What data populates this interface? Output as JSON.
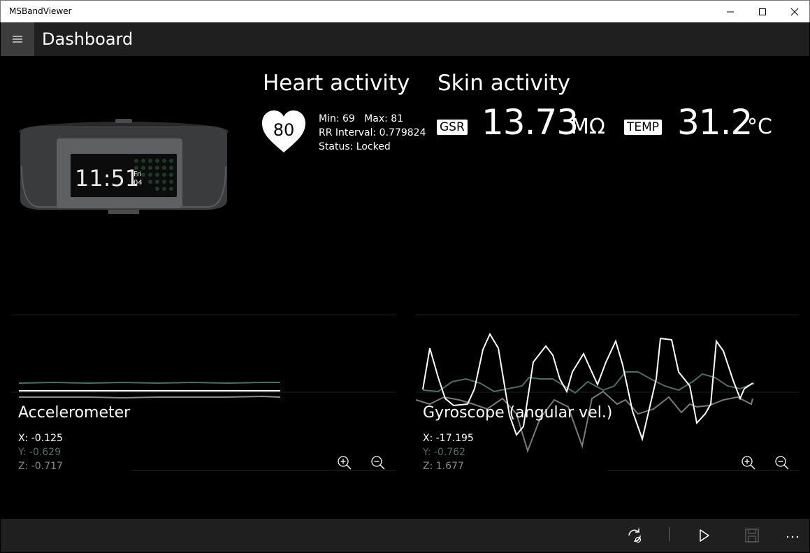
{
  "window": {
    "title": "MSBandViewer"
  },
  "appbar": {
    "title": "Dashboard"
  },
  "band": {
    "time": "11:51",
    "day": "Fri",
    "date": "04"
  },
  "heart": {
    "title": "Heart activity",
    "bpm": "80",
    "min_max": "Min: 69   Max: 81",
    "rr": "RR Interval: 0.779824",
    "status": "Status: Locked"
  },
  "skin": {
    "title": "Skin activity",
    "gsr_label": "GSR",
    "gsr_value": "13.73",
    "gsr_unit": "MΩ",
    "temp_label": "TEMP",
    "temp_value": "31.2",
    "temp_unit": "°C"
  },
  "accelerometer": {
    "title": "Accelerometer",
    "x": "X: -0.125",
    "y": "Y: -0.629",
    "z": "Z: -0.717"
  },
  "gyroscope": {
    "title": "Gyroscope (angular vel.)",
    "x": "X: -17.195",
    "y": "Y: -0.762",
    "z": "Z: 1.677"
  },
  "colors": {
    "series_x": "#ffffff",
    "series_y": "#4c6f63",
    "series_z": "#8a8a8a",
    "appbar": "#1f1f1f"
  },
  "icons": {
    "hamburger": "hamburger-icon",
    "zoom_in": "zoom-in-icon",
    "zoom_out": "zoom-out-icon",
    "sync": "sync-icon",
    "play": "play-icon",
    "save": "save-icon",
    "more": "more-icon"
  }
}
